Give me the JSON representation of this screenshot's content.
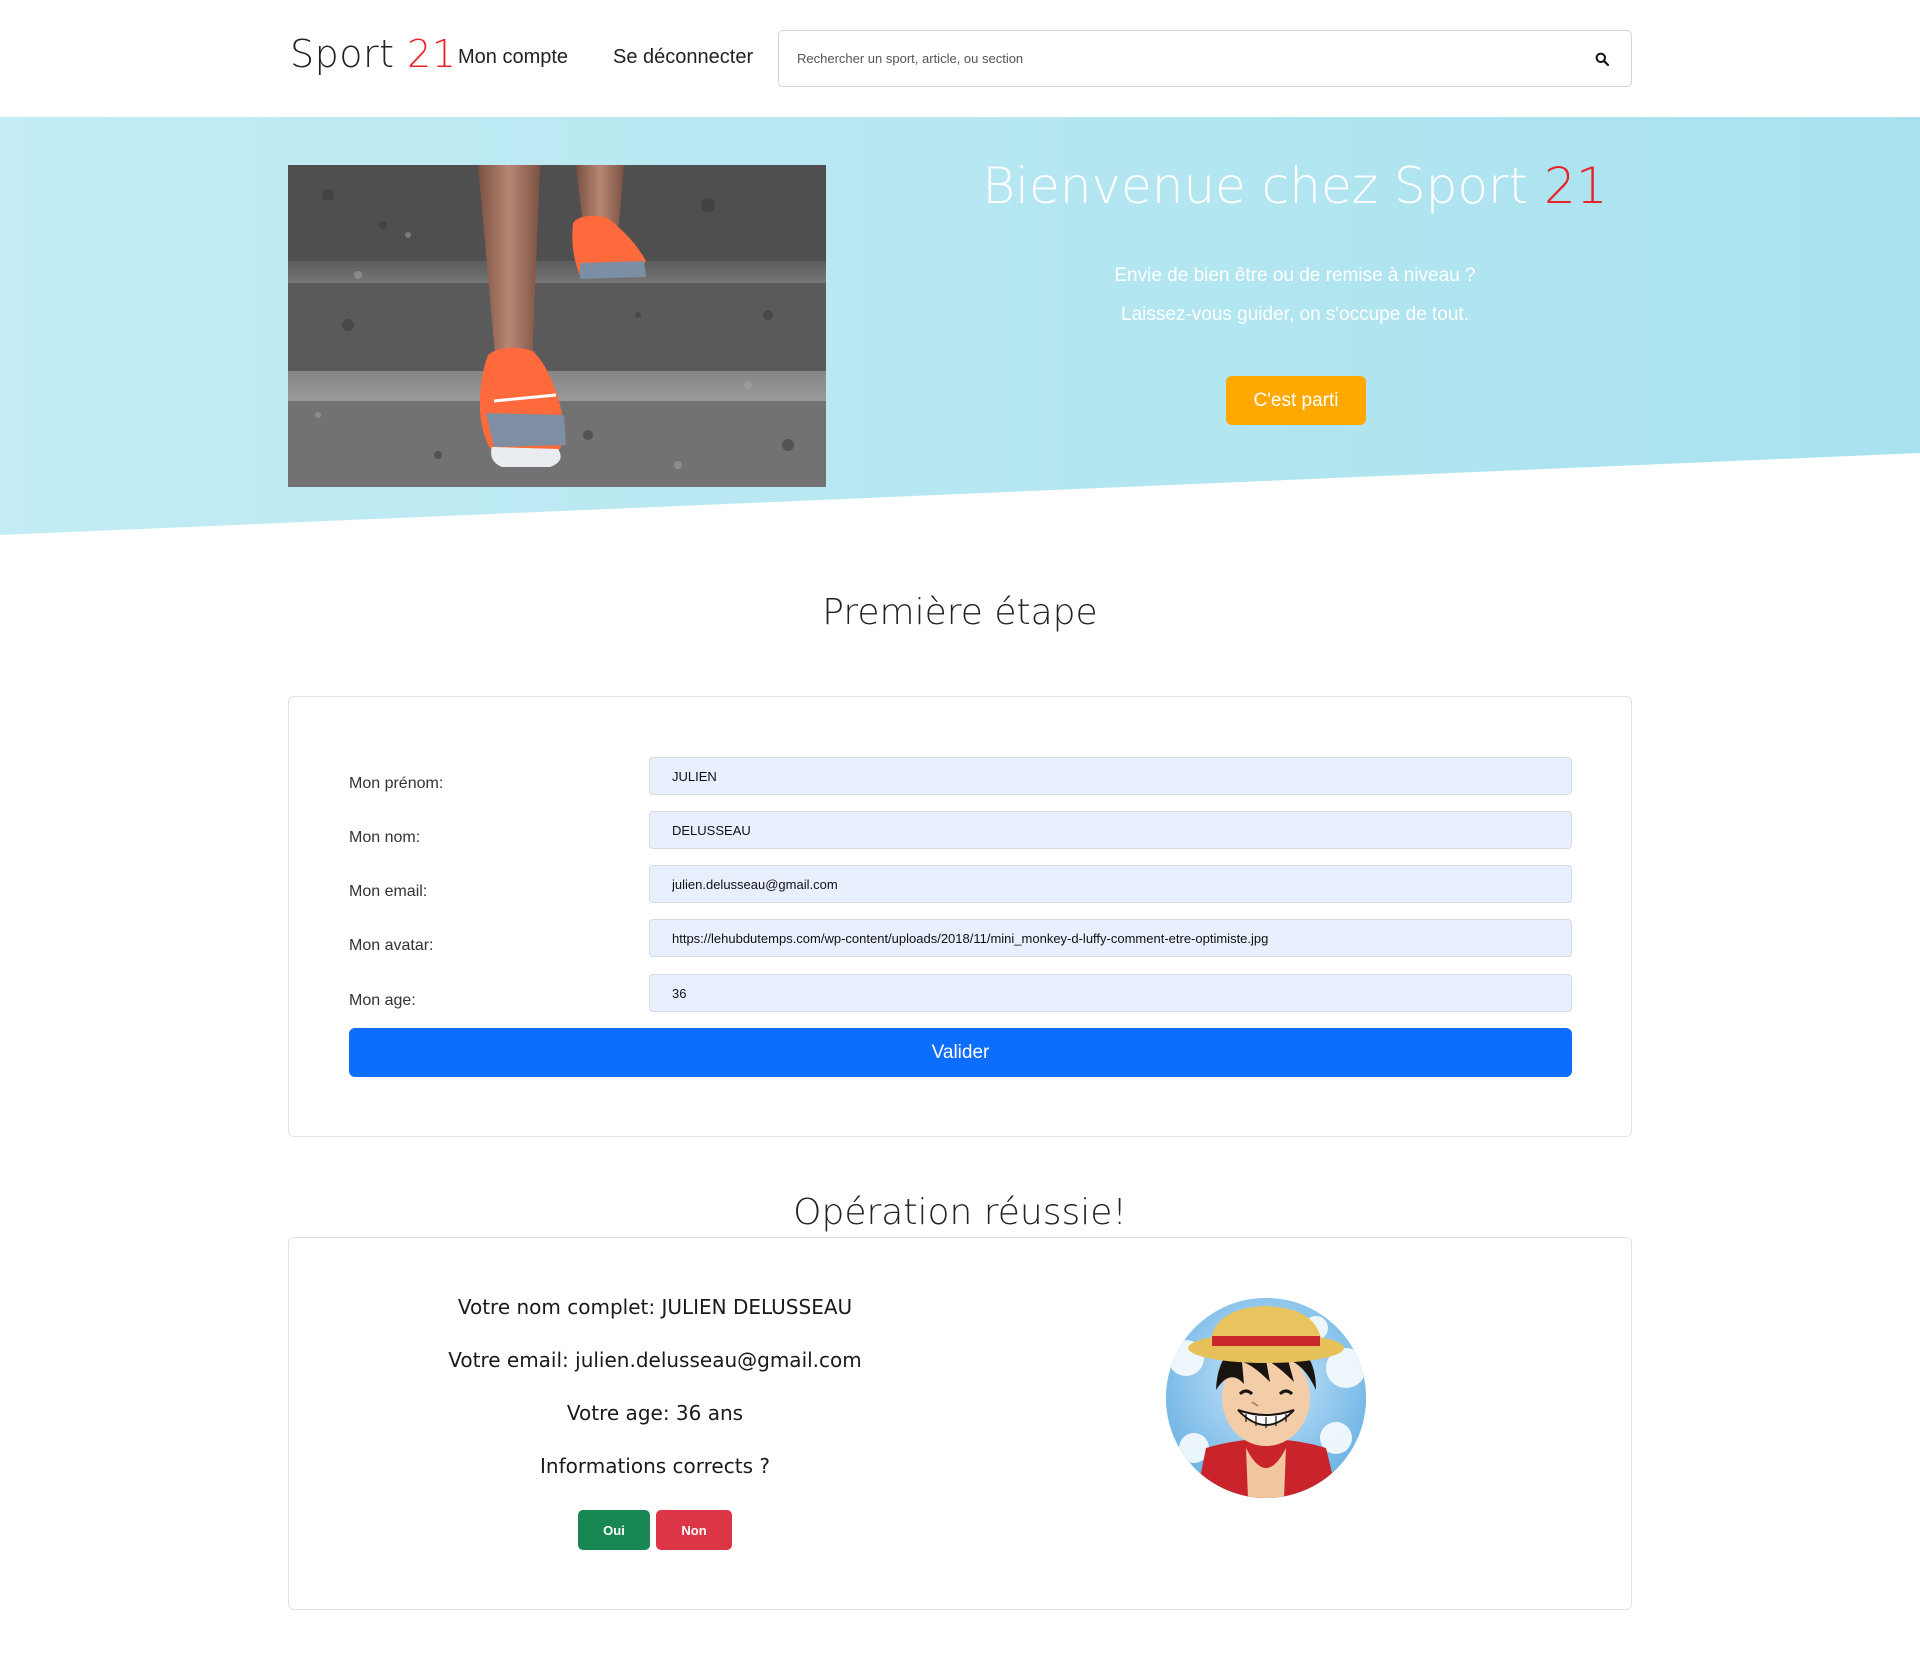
{
  "header": {
    "brand_name": "Sport",
    "brand_number": "21",
    "nav": {
      "account": "Mon compte",
      "logout": "Se déconnecter"
    },
    "search": {
      "placeholder": "Rechercher un sport, article, ou section",
      "icon": "search-icon"
    }
  },
  "hero": {
    "title_text": "Bienvenue chez Sport",
    "title_number": "21",
    "line1": "Envie de bien être ou de remise à niveau ?",
    "line2": "Laissez-vous guider, on s'occupe de tout.",
    "cta_label": "C'est parti",
    "colors": {
      "bg_from": "#c3ecf4",
      "bg_to": "#a9e2ef",
      "cta": "#ffa800",
      "accent_number": "#e8232a"
    }
  },
  "form": {
    "title": "Première étape",
    "fields": [
      {
        "label": "Mon prénom:",
        "value": "JULIEN"
      },
      {
        "label": "Mon nom:",
        "value": "DELUSSEAU"
      },
      {
        "label": "Mon email:",
        "value": "julien.delusseau@gmail.com"
      },
      {
        "label": "Mon avatar:",
        "value": "https://lehubdutemps.com/wp-content/uploads/2018/11/mini_monkey-d-luffy-comment-etre-optimiste.jpg"
      },
      {
        "label": "Mon age:",
        "value": "36"
      }
    ],
    "submit_label": "Valider",
    "colors": {
      "input_bg": "#e8f0fe",
      "submit": "#0d6efd"
    }
  },
  "result": {
    "title": "Opération réussie!",
    "full_name": "Votre nom complet: JULIEN DELUSSEAU",
    "email": "Votre email: julien.delusseau@gmail.com",
    "age": "Votre age: 36 ans",
    "question": "Informations corrects ?",
    "yes_label": "Oui",
    "no_label": "Non",
    "colors": {
      "yes": "#198754",
      "no": "#dc3545"
    }
  }
}
